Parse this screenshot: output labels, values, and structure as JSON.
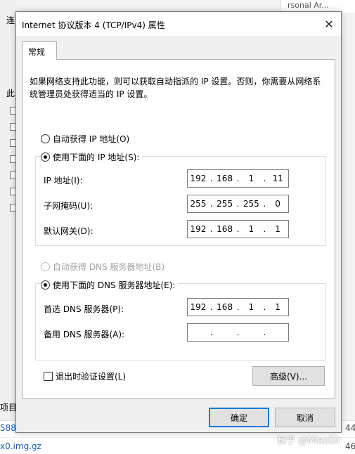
{
  "background": {
    "top_right_text": "rsonal Ar...",
    "left_fragments": [
      "连",
      "此",
      "项目"
    ],
    "bottom_link_1": "588",
    "bottom_link_2": "x0.img.gz",
    "bottom_num_1": "44",
    "bottom_num_2": "46"
  },
  "dialog": {
    "title": "Internet 协议版本 4 (TCP/IPv4) 属性",
    "close_glyph": "✕",
    "tab_label": "常规",
    "description": "如果网络支持此功能，则可以获取自动指派的 IP 设置。否则，你需要从网络系统管理员处获得适当的 IP 设置。",
    "auto_ip_label": "自动获得 IP 地址(O)",
    "manual_ip_label": "使用下面的 IP 地址(S):",
    "ip_label": "IP 地址(I):",
    "ip_value": [
      "192",
      "168",
      "1",
      "11"
    ],
    "mask_label": "子网掩码(U):",
    "mask_value": [
      "255",
      "255",
      "255",
      "0"
    ],
    "gateway_label": "默认网关(D):",
    "gateway_value": [
      "192",
      "168",
      "1",
      "1"
    ],
    "auto_dns_label": "自动获得 DNS 服务器地址(B)",
    "manual_dns_label": "使用下面的 DNS 服务器地址(E):",
    "preferred_dns_label": "首选 DNS 服务器(P):",
    "preferred_dns_value": [
      "192",
      "168",
      "1",
      "1"
    ],
    "alternate_dns_label": "备用 DNS 服务器(A):",
    "alternate_dns_value": [
      "",
      "",
      "",
      ""
    ],
    "validate_label": "退出时验证设置(L)",
    "advanced_button": "高级(V)...",
    "ok_button": "确定",
    "cancel_button": "取消"
  },
  "watermark": "知乎 @MiaoSir",
  "colors": {
    "accent": "#0078d7",
    "disabled_text": "#a0a0a0"
  }
}
